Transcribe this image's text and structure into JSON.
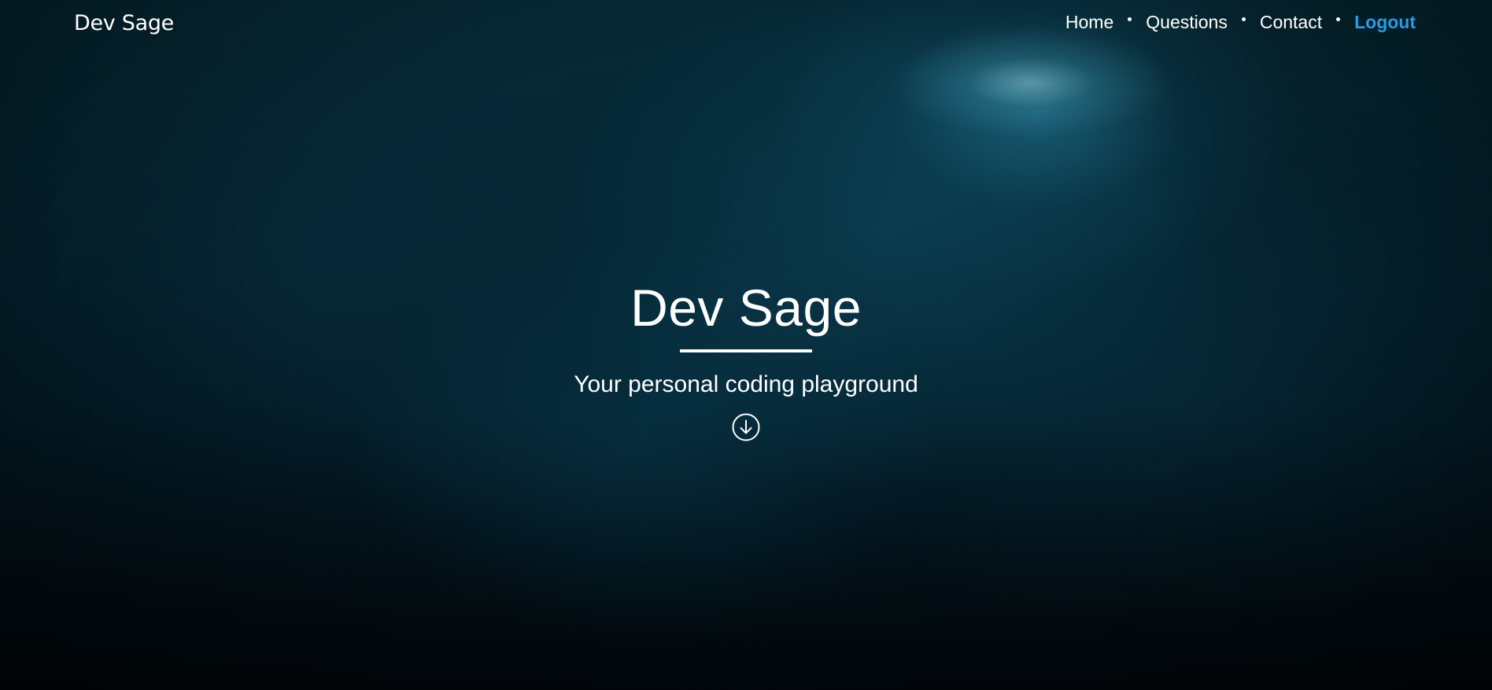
{
  "header": {
    "brand": "Dev Sage",
    "nav": [
      {
        "label": "Home"
      },
      {
        "label": "Questions"
      },
      {
        "label": "Contact"
      },
      {
        "label": "Logout",
        "active": true
      }
    ]
  },
  "hero": {
    "title": "Dev Sage",
    "subtitle": "Your personal coding playground",
    "scroll_icon": "arrow-circle-down-icon"
  },
  "colors": {
    "accent": "#2b9be6",
    "text": "#ffffff",
    "background": "#052330"
  }
}
